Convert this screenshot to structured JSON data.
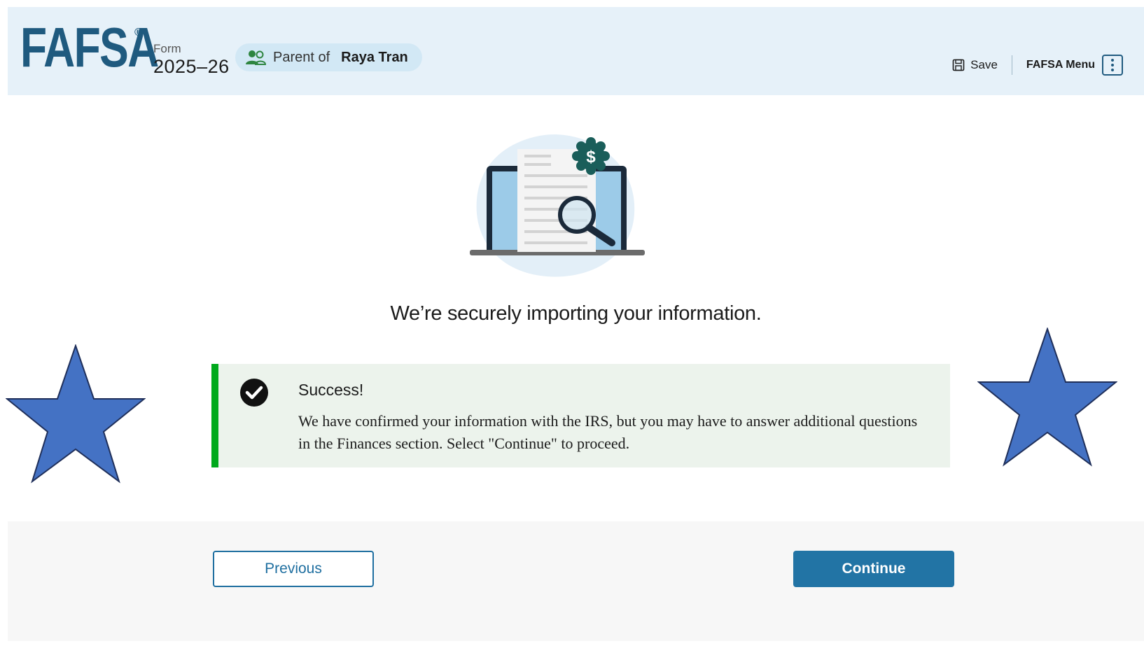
{
  "header": {
    "logo": "FAFSA",
    "logo_mark": "®",
    "form_label": "Form",
    "form_year": "2025–26",
    "role_prefix": "Parent of",
    "role_name": "Raya Tran",
    "save_label": "Save",
    "menu_label": "FAFSA Menu"
  },
  "main": {
    "headline": "We’re securely importing your information.",
    "alert": {
      "title": "Success!",
      "body": "We have confirmed your information with the IRS, but you may have to answer additional questions in the Finances section. Select \"Continue\" to proceed."
    }
  },
  "footer": {
    "previous_label": "Previous",
    "continue_label": "Continue"
  },
  "colors": {
    "header_bg": "#e6f1f9",
    "brand": "#1f5a7f",
    "success_border": "#00a91c",
    "success_bg": "#ecf3ec",
    "primary_button": "#2274a5",
    "star_fill": "#4472c4"
  },
  "icons": [
    "people-icon",
    "save-icon",
    "kebab-menu-icon",
    "document-search-illustration",
    "checkmark-circle-icon",
    "star-icon"
  ]
}
